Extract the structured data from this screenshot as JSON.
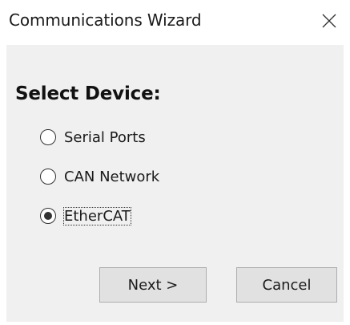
{
  "window": {
    "title": "Communications Wizard",
    "close_icon": "close-icon"
  },
  "main": {
    "heading": "Select Device:",
    "options": [
      {
        "label": "Serial Ports",
        "selected": false
      },
      {
        "label": "CAN Network",
        "selected": false
      },
      {
        "label": "EtherCAT",
        "selected": true
      }
    ]
  },
  "buttons": {
    "next_label": "Next >",
    "cancel_label": "Cancel"
  }
}
